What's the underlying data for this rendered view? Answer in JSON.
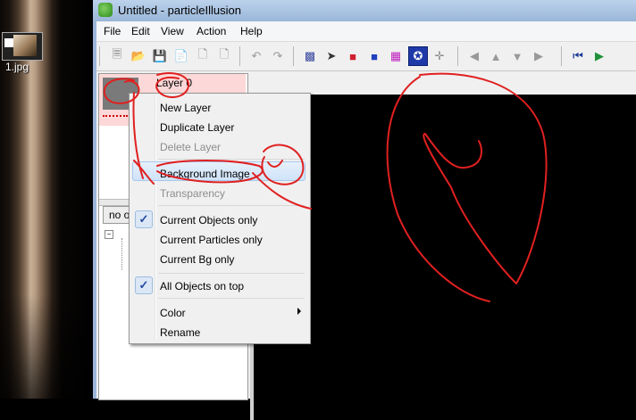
{
  "desktop": {
    "icon_label": "1.jpg"
  },
  "window": {
    "title": "Untitled - particleIllusion"
  },
  "menubar": {
    "items": [
      "File",
      "Edit",
      "View",
      "Action",
      "Help"
    ]
  },
  "toolbar": {
    "groups": [
      [
        "page-icon",
        "open-folder-icon",
        "save-icon",
        "save-as-icon",
        "document-icon",
        "document-alt-icon"
      ],
      [
        "undo-icon",
        "redo-icon"
      ],
      [
        "cube-icon",
        "pointer-icon",
        "red-shape-icon",
        "blue-shape-icon",
        "magenta-shape-icon",
        "particle-tool-icon",
        "move-icon"
      ],
      [
        "arrow-left-icon",
        "arrow-up-icon",
        "arrow-down-icon",
        "arrow-right-icon"
      ],
      [
        "rewind-icon",
        "play-icon"
      ]
    ]
  },
  "layers": {
    "layer_name": "Layer 0"
  },
  "objects_tab": {
    "label": "no ob"
  },
  "context_menu": {
    "items": [
      {
        "label": "New Layer",
        "disabled": false
      },
      {
        "label": "Duplicate Layer",
        "disabled": false
      },
      {
        "label": "Delete Layer",
        "disabled": true
      },
      {
        "label": "Background Image",
        "disabled": false,
        "highlighted": true
      },
      {
        "label": "Transparency",
        "disabled": true
      },
      {
        "label": "Current Objects only",
        "checked": true
      },
      {
        "label": "Current Particles only",
        "checked": false
      },
      {
        "label": "Current Bg only",
        "checked": false
      },
      {
        "label": "All Objects on top",
        "checked": true
      },
      {
        "label": "Color",
        "submenu": true
      },
      {
        "label": "Rename"
      }
    ]
  },
  "colors": {
    "annotation_red": "#e02020",
    "menu_highlight": "#cfe3f9",
    "layer_selected_bg": "#fdd8d8",
    "canvas_bg": "#000000"
  }
}
